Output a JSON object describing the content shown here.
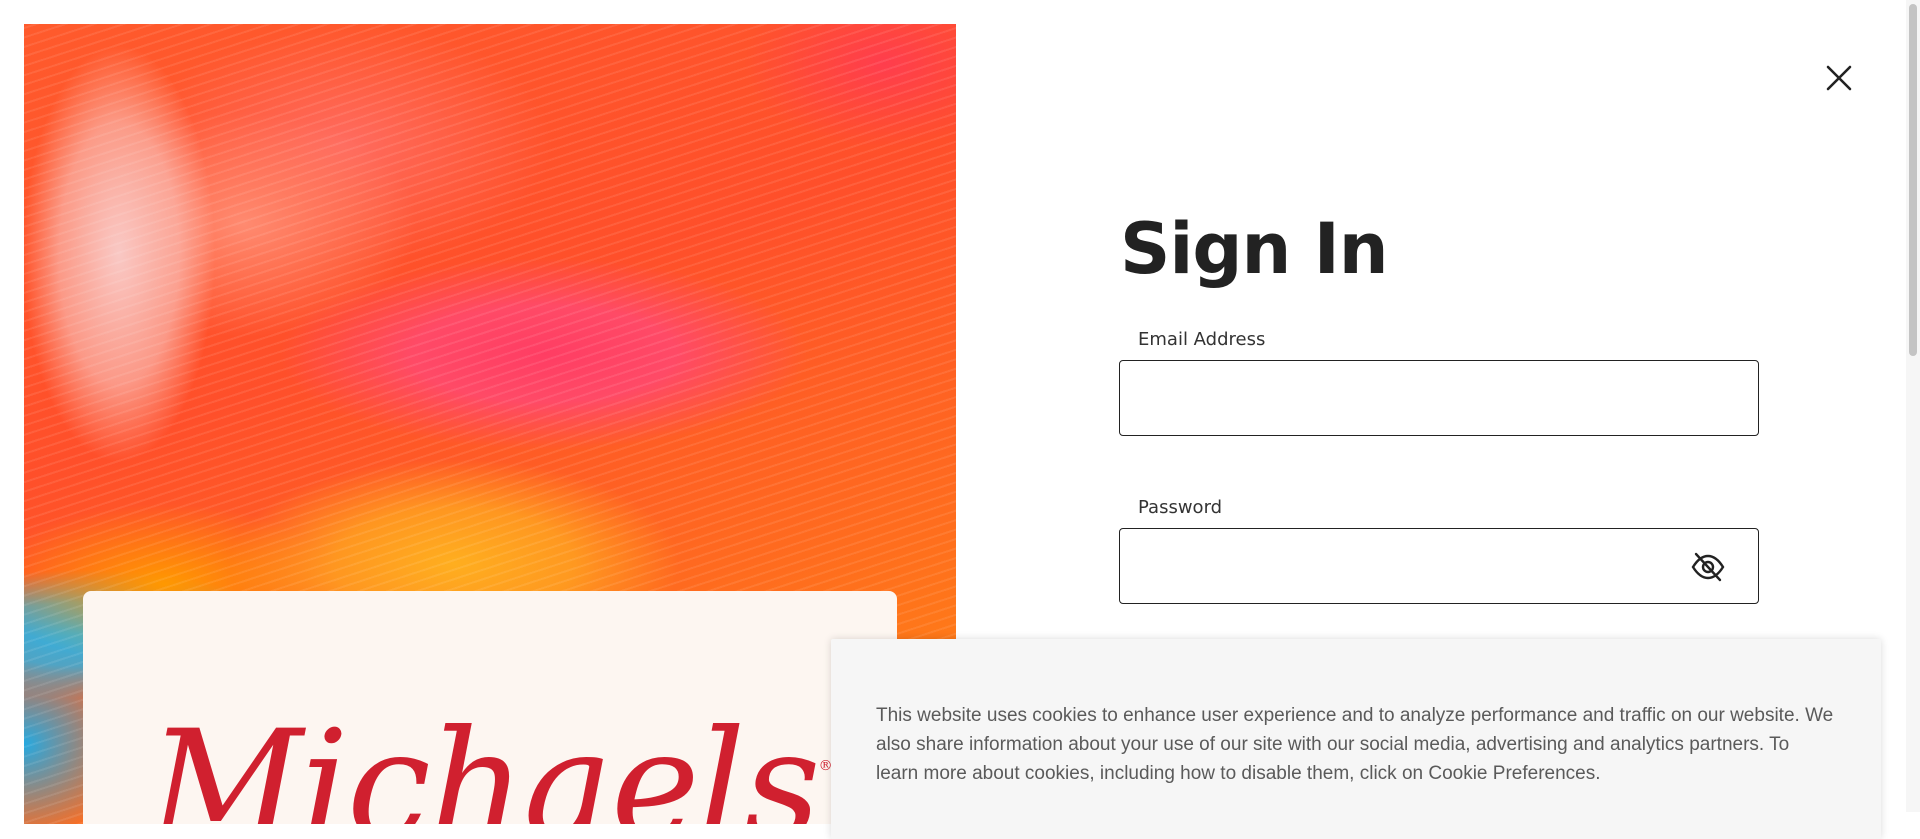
{
  "hero": {
    "logo_text": "Michaels",
    "logo_mark": "®",
    "background": "abstract-paint-art",
    "logo_color": "#d0202f"
  },
  "dialog": {
    "close_icon": "close-icon",
    "title": "Sign In",
    "email": {
      "label": "Email Address",
      "value": "",
      "placeholder": ""
    },
    "password": {
      "label": "Password",
      "value": "",
      "placeholder": "",
      "toggle_icon": "eye-slash-icon"
    }
  },
  "cookie_banner": {
    "text": "This website uses cookies to enhance user experience and to analyze performance and traffic on our website. We also share information about your use of our site with our social media, advertising and analytics partners. To learn more about cookies, including how to disable them, click on Cookie Preferences."
  }
}
